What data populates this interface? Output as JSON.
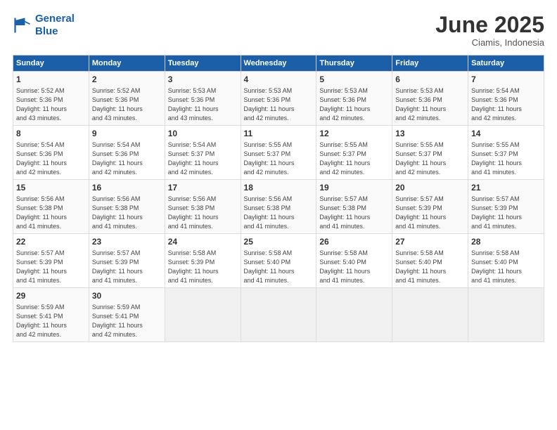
{
  "logo": {
    "line1": "General",
    "line2": "Blue"
  },
  "title": "June 2025",
  "subtitle": "Ciamis, Indonesia",
  "header_days": [
    "Sunday",
    "Monday",
    "Tuesday",
    "Wednesday",
    "Thursday",
    "Friday",
    "Saturday"
  ],
  "weeks": [
    [
      {
        "day": "1",
        "info": "Sunrise: 5:52 AM\nSunset: 5:36 PM\nDaylight: 11 hours\nand 43 minutes."
      },
      {
        "day": "2",
        "info": "Sunrise: 5:52 AM\nSunset: 5:36 PM\nDaylight: 11 hours\nand 43 minutes."
      },
      {
        "day": "3",
        "info": "Sunrise: 5:53 AM\nSunset: 5:36 PM\nDaylight: 11 hours\nand 43 minutes."
      },
      {
        "day": "4",
        "info": "Sunrise: 5:53 AM\nSunset: 5:36 PM\nDaylight: 11 hours\nand 42 minutes."
      },
      {
        "day": "5",
        "info": "Sunrise: 5:53 AM\nSunset: 5:36 PM\nDaylight: 11 hours\nand 42 minutes."
      },
      {
        "day": "6",
        "info": "Sunrise: 5:53 AM\nSunset: 5:36 PM\nDaylight: 11 hours\nand 42 minutes."
      },
      {
        "day": "7",
        "info": "Sunrise: 5:54 AM\nSunset: 5:36 PM\nDaylight: 11 hours\nand 42 minutes."
      }
    ],
    [
      {
        "day": "8",
        "info": "Sunrise: 5:54 AM\nSunset: 5:36 PM\nDaylight: 11 hours\nand 42 minutes."
      },
      {
        "day": "9",
        "info": "Sunrise: 5:54 AM\nSunset: 5:36 PM\nDaylight: 11 hours\nand 42 minutes."
      },
      {
        "day": "10",
        "info": "Sunrise: 5:54 AM\nSunset: 5:37 PM\nDaylight: 11 hours\nand 42 minutes."
      },
      {
        "day": "11",
        "info": "Sunrise: 5:55 AM\nSunset: 5:37 PM\nDaylight: 11 hours\nand 42 minutes."
      },
      {
        "day": "12",
        "info": "Sunrise: 5:55 AM\nSunset: 5:37 PM\nDaylight: 11 hours\nand 42 minutes."
      },
      {
        "day": "13",
        "info": "Sunrise: 5:55 AM\nSunset: 5:37 PM\nDaylight: 11 hours\nand 42 minutes."
      },
      {
        "day": "14",
        "info": "Sunrise: 5:55 AM\nSunset: 5:37 PM\nDaylight: 11 hours\nand 41 minutes."
      }
    ],
    [
      {
        "day": "15",
        "info": "Sunrise: 5:56 AM\nSunset: 5:38 PM\nDaylight: 11 hours\nand 41 minutes."
      },
      {
        "day": "16",
        "info": "Sunrise: 5:56 AM\nSunset: 5:38 PM\nDaylight: 11 hours\nand 41 minutes."
      },
      {
        "day": "17",
        "info": "Sunrise: 5:56 AM\nSunset: 5:38 PM\nDaylight: 11 hours\nand 41 minutes."
      },
      {
        "day": "18",
        "info": "Sunrise: 5:56 AM\nSunset: 5:38 PM\nDaylight: 11 hours\nand 41 minutes."
      },
      {
        "day": "19",
        "info": "Sunrise: 5:57 AM\nSunset: 5:38 PM\nDaylight: 11 hours\nand 41 minutes."
      },
      {
        "day": "20",
        "info": "Sunrise: 5:57 AM\nSunset: 5:39 PM\nDaylight: 11 hours\nand 41 minutes."
      },
      {
        "day": "21",
        "info": "Sunrise: 5:57 AM\nSunset: 5:39 PM\nDaylight: 11 hours\nand 41 minutes."
      }
    ],
    [
      {
        "day": "22",
        "info": "Sunrise: 5:57 AM\nSunset: 5:39 PM\nDaylight: 11 hours\nand 41 minutes."
      },
      {
        "day": "23",
        "info": "Sunrise: 5:57 AM\nSunset: 5:39 PM\nDaylight: 11 hours\nand 41 minutes."
      },
      {
        "day": "24",
        "info": "Sunrise: 5:58 AM\nSunset: 5:39 PM\nDaylight: 11 hours\nand 41 minutes."
      },
      {
        "day": "25",
        "info": "Sunrise: 5:58 AM\nSunset: 5:40 PM\nDaylight: 11 hours\nand 41 minutes."
      },
      {
        "day": "26",
        "info": "Sunrise: 5:58 AM\nSunset: 5:40 PM\nDaylight: 11 hours\nand 41 minutes."
      },
      {
        "day": "27",
        "info": "Sunrise: 5:58 AM\nSunset: 5:40 PM\nDaylight: 11 hours\nand 41 minutes."
      },
      {
        "day": "28",
        "info": "Sunrise: 5:58 AM\nSunset: 5:40 PM\nDaylight: 11 hours\nand 41 minutes."
      }
    ],
    [
      {
        "day": "29",
        "info": "Sunrise: 5:59 AM\nSunset: 5:41 PM\nDaylight: 11 hours\nand 42 minutes."
      },
      {
        "day": "30",
        "info": "Sunrise: 5:59 AM\nSunset: 5:41 PM\nDaylight: 11 hours\nand 42 minutes."
      },
      {
        "day": "",
        "info": ""
      },
      {
        "day": "",
        "info": ""
      },
      {
        "day": "",
        "info": ""
      },
      {
        "day": "",
        "info": ""
      },
      {
        "day": "",
        "info": ""
      }
    ]
  ]
}
